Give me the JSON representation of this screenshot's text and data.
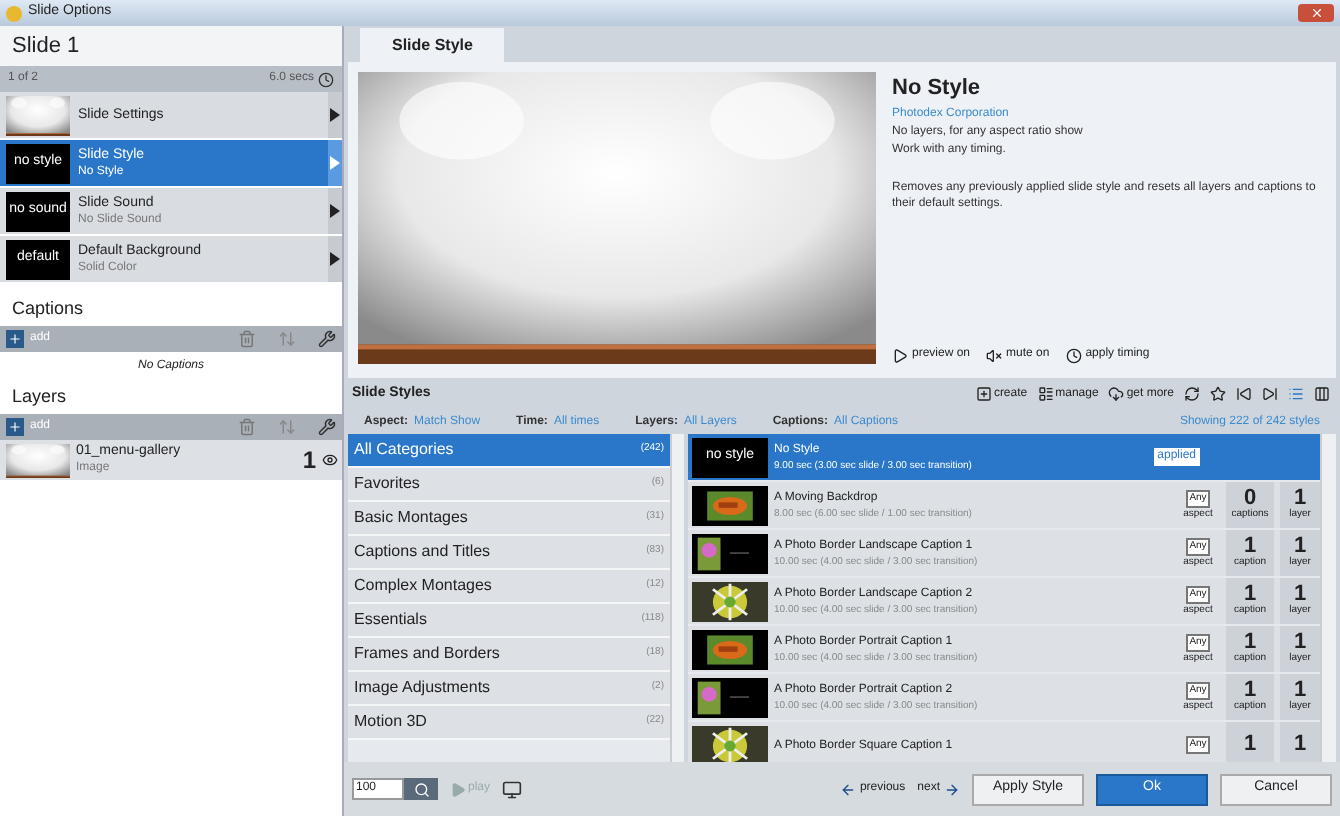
{
  "window": {
    "title": "Slide Options"
  },
  "slide_panel": {
    "title": "Slide 1",
    "position": "1 of 2",
    "duration": "6.0 secs",
    "items": [
      {
        "title": "Slide Settings",
        "selected": false
      },
      {
        "title": "Slide Style",
        "subtitle": "No Style",
        "thumb": {
          "kind": "label",
          "text": "no style"
        },
        "selected": true
      },
      {
        "title": "Slide Sound",
        "subtitle": "No Slide Sound",
        "thumb": {
          "kind": "label",
          "text": "no sound"
        },
        "selected": false
      },
      {
        "title": "Default Background",
        "subtitle": "Solid Color",
        "thumb": {
          "kind": "label",
          "text": "default"
        },
        "selected": false
      }
    ]
  },
  "captions": {
    "title": "Captions",
    "add": "add",
    "empty": "No Captions"
  },
  "layers": {
    "title": "Layers",
    "add": "add",
    "items": [
      {
        "name": "01_menu-gallery",
        "type": "Image",
        "number": "1"
      }
    ]
  },
  "tabs": [
    {
      "label": "Slide Style",
      "selected": true
    }
  ],
  "preview": {
    "name": "No Style",
    "author": "Photodex Corporation",
    "lines": [
      "No layers, for any aspect ratio show",
      "Work with any timing."
    ],
    "description": "Removes any previously applied slide style and resets all layers and captions to their default settings.",
    "options": [
      {
        "kind": "play",
        "label": "preview on"
      },
      {
        "kind": "mute",
        "label": "mute on"
      },
      {
        "kind": "timing",
        "label": "apply timing"
      }
    ]
  },
  "styles": {
    "title": "Slide Styles",
    "toolbar": [
      {
        "kind": "create",
        "label": "create"
      },
      {
        "kind": "manage",
        "label": "manage"
      },
      {
        "kind": "get_more",
        "label": "get more"
      },
      {
        "kind": "refresh"
      },
      {
        "kind": "favorite"
      },
      {
        "kind": "first"
      },
      {
        "kind": "last"
      },
      {
        "kind": "list_view",
        "selected": true
      },
      {
        "kind": "grid_view",
        "selected": false
      }
    ],
    "filters": [
      {
        "label": "Aspect:",
        "value": "Match Show"
      },
      {
        "label": "Time:",
        "value": "All times"
      },
      {
        "label": "Layers:",
        "value": "All Layers"
      },
      {
        "label": "Captions:",
        "value": "All Captions"
      }
    ],
    "count": "Showing 222 of 242 styles",
    "categories": [
      {
        "name": "All Categories",
        "count": "(242)",
        "selected": true
      },
      {
        "name": "Favorites",
        "count": "(6)",
        "selected": false
      },
      {
        "name": "Basic Montages",
        "count": "(31)",
        "selected": false
      },
      {
        "name": "Captions and Titles",
        "count": "(83)",
        "selected": false
      },
      {
        "name": "Complex Montages",
        "count": "(12)",
        "selected": false
      },
      {
        "name": "Essentials",
        "count": "(118)",
        "selected": false
      },
      {
        "name": "Frames and Borders",
        "count": "(18)",
        "selected": false
      },
      {
        "name": "Image Adjustments",
        "count": "(2)",
        "selected": false
      },
      {
        "name": "Motion 3D",
        "count": "(22)",
        "selected": false
      }
    ],
    "items": [
      {
        "name": "No Style",
        "timing": "9.00 sec (3.00 sec slide / 3.00 sec transition)",
        "thumb": {
          "kind": "label",
          "text": "no style"
        },
        "badge": "applied",
        "selected": true
      },
      {
        "name": "A Moving Backdrop",
        "timing": "8.00 sec (6.00 sec slide / 1.00 sec transition)",
        "aspect": "Any",
        "aspect_label": "aspect",
        "captions": "0",
        "captions_label": "captions",
        "layers": "1",
        "layers_label": "layer",
        "selected": false
      },
      {
        "name": "A Photo Border Landscape Caption 1",
        "timing": "10.00 sec (4.00 sec slide / 3.00 sec transition)",
        "aspect": "Any",
        "aspect_label": "aspect",
        "captions": "1",
        "captions_label": "caption",
        "layers": "1",
        "layers_label": "layer",
        "selected": false
      },
      {
        "name": "A Photo Border Landscape Caption 2",
        "timing": "10.00 sec (4.00 sec slide / 3.00 sec transition)",
        "aspect": "Any",
        "aspect_label": "aspect",
        "captions": "1",
        "captions_label": "caption",
        "layers": "1",
        "layers_label": "layer",
        "selected": false
      },
      {
        "name": "A Photo Border Portrait Caption 1",
        "timing": "10.00 sec (4.00 sec slide / 3.00 sec transition)",
        "aspect": "Any",
        "aspect_label": "aspect",
        "captions": "1",
        "captions_label": "caption",
        "layers": "1",
        "layers_label": "layer",
        "selected": false
      },
      {
        "name": "A Photo Border Portrait Caption 2",
        "timing": "10.00 sec (4.00 sec slide / 3.00 sec transition)",
        "aspect": "Any",
        "aspect_label": "aspect",
        "captions": "1",
        "captions_label": "caption",
        "layers": "1",
        "layers_label": "layer",
        "selected": false
      },
      {
        "name": "A Photo Border Square Caption 1",
        "aspect": "Any",
        "captions": "1",
        "layers": "1",
        "selected": false
      }
    ]
  },
  "bottom": {
    "zoom": "100",
    "play": {
      "label": "play",
      "disabled": true
    },
    "previous": "previous",
    "next": "next",
    "buttons": [
      {
        "label": "Apply Style",
        "kind": "secondary"
      },
      {
        "label": "Ok",
        "kind": "primary"
      },
      {
        "label": "Cancel",
        "kind": "secondary"
      }
    ]
  }
}
